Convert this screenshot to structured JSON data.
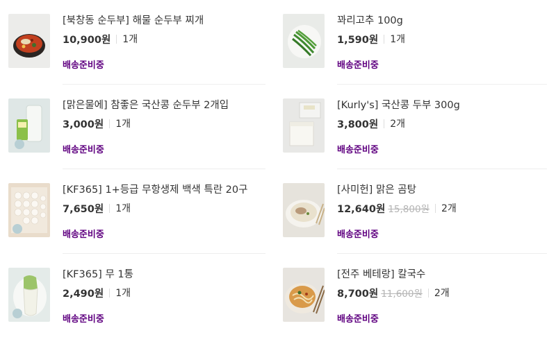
{
  "orders": [
    {
      "name": "[북창동 순두부] 해물 순두부 찌개",
      "price": "10,900원",
      "original_price": "",
      "qty": "1개",
      "status": "배송준비중",
      "thumb": "stew-icon"
    },
    {
      "name": "꽈리고추 100g",
      "price": "1,590원",
      "original_price": "",
      "qty": "1개",
      "status": "배송준비중",
      "thumb": "pepper-icon"
    },
    {
      "name": "[맑은물에] 참좋은 국산콩 순두부 2개입",
      "price": "3,000원",
      "original_price": "",
      "qty": "1개",
      "status": "배송준비중",
      "thumb": "tofu-pack-icon"
    },
    {
      "name": "[Kurly's] 국산콩 두부 300g",
      "price": "3,800원",
      "original_price": "",
      "qty": "2개",
      "status": "배송준비중",
      "thumb": "tofu-block-icon"
    },
    {
      "name": "[KF365] 1+등급 무항생제 백색 특란 20구",
      "price": "7,650원",
      "original_price": "",
      "qty": "1개",
      "status": "배송준비중",
      "thumb": "eggs-icon"
    },
    {
      "name": "[사미헌] 맑은 곰탕",
      "price": "12,640원",
      "original_price": "15,800원",
      "qty": "2개",
      "status": "배송준비중",
      "thumb": "soup-icon"
    },
    {
      "name": "[KF365] 무 1통",
      "price": "2,490원",
      "original_price": "",
      "qty": "1개",
      "status": "배송준비중",
      "thumb": "radish-icon"
    },
    {
      "name": "[전주 베테랑] 칼국수",
      "price": "8,700원",
      "original_price": "11,600원",
      "qty": "2개",
      "status": "배송준비중",
      "thumb": "noodles-icon"
    }
  ],
  "colors": {
    "status": "#5f0080",
    "text": "#333333",
    "strike": "#b5b5b5",
    "divider": "#eeeeee"
  }
}
